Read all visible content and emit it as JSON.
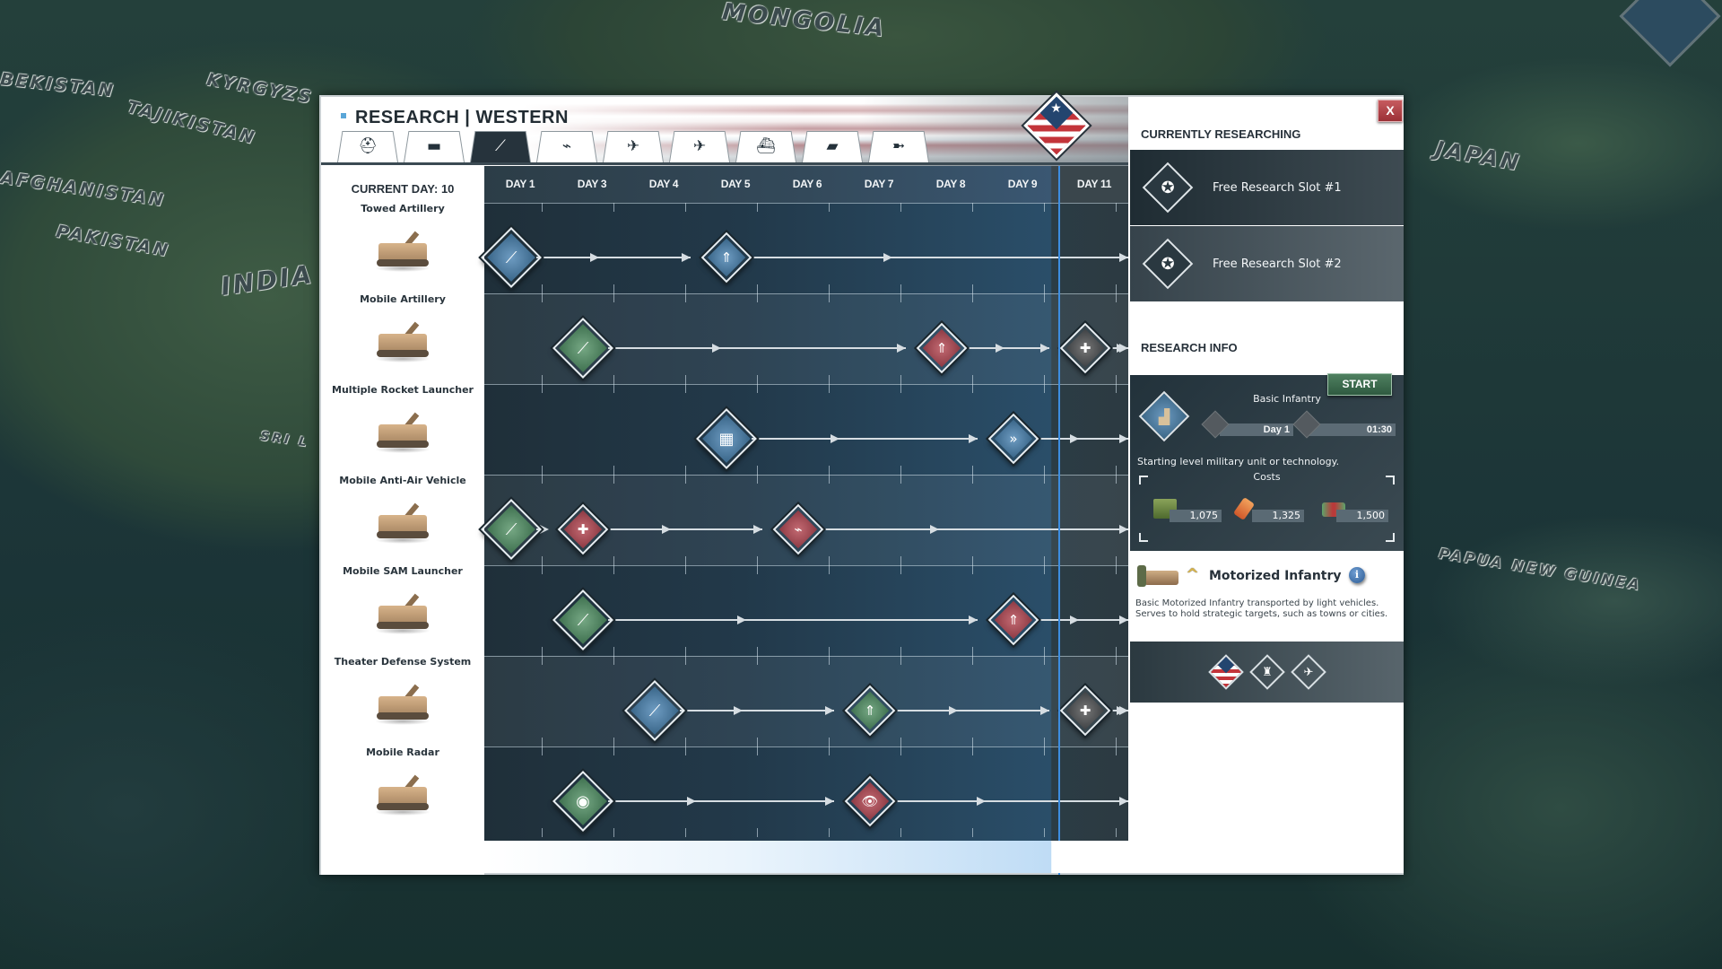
{
  "map": {
    "labels": [
      "MONGOLIA",
      "BEKISTAN",
      "KYRGYZS",
      "TAJIKISTAN",
      "AFGHANISTAN",
      "PAKISTAN",
      "INDIA",
      "SRI L",
      "JAPAN",
      "PAPUA NEW GUINEA"
    ]
  },
  "window": {
    "title": "RESEARCH | WESTERN",
    "close_label": "X",
    "tabs": [
      {
        "name": "infantry",
        "icon": "helmet-icon",
        "glyph": "⛑",
        "active": false
      },
      {
        "name": "tanks",
        "icon": "tank-icon",
        "glyph": "▬",
        "active": false
      },
      {
        "name": "artillery",
        "icon": "artillery-icon",
        "glyph": "⟋",
        "active": true
      },
      {
        "name": "helicopters",
        "icon": "helicopter-icon",
        "glyph": "⌁",
        "active": false
      },
      {
        "name": "fighters",
        "icon": "fighter-jet-icon",
        "glyph": "✈",
        "active": false
      },
      {
        "name": "aircraft",
        "icon": "aircraft-icon",
        "glyph": "✈",
        "active": false
      },
      {
        "name": "ships",
        "icon": "ship-icon",
        "glyph": "⛴",
        "active": false
      },
      {
        "name": "submarines",
        "icon": "submarine-icon",
        "glyph": "▰",
        "active": false
      },
      {
        "name": "missiles",
        "icon": "missile-icon",
        "glyph": "➼",
        "active": false
      }
    ]
  },
  "timeline": {
    "current_day_label": "CURRENT DAY: 10",
    "days": [
      "DAY 1",
      "DAY 3",
      "DAY 4",
      "DAY 5",
      "DAY 6",
      "DAY 7",
      "DAY 8",
      "DAY 9",
      "DAY 11"
    ],
    "current_day_after_column": 7,
    "units": [
      {
        "name": "Towed Artillery",
        "nodes": [
          {
            "col": 0,
            "color": "blue",
            "kind": "unit",
            "glyph": "⟋"
          },
          {
            "col": 3,
            "color": "blue",
            "kind": "upgrade",
            "glyph": "⇑"
          }
        ]
      },
      {
        "name": "Mobile Artillery",
        "nodes": [
          {
            "col": 1,
            "color": "green",
            "kind": "unit",
            "glyph": "⟋"
          },
          {
            "col": 6,
            "color": "red",
            "kind": "upgrade",
            "glyph": "⇑"
          },
          {
            "col": 8,
            "color": "grey",
            "kind": "upgrade",
            "glyph": "✚"
          }
        ]
      },
      {
        "name": "Multiple Rocket Launcher",
        "nodes": [
          {
            "col": 3,
            "color": "blue",
            "kind": "unit",
            "glyph": "▦"
          },
          {
            "col": 7,
            "color": "blue",
            "kind": "upgrade",
            "glyph": "»"
          }
        ]
      },
      {
        "name": "Mobile Anti-Air Vehicle",
        "nodes": [
          {
            "col": 0,
            "color": "green",
            "kind": "unit",
            "glyph": "⟋"
          },
          {
            "col": 1,
            "color": "red",
            "kind": "upgrade",
            "glyph": "✚"
          },
          {
            "col": 4,
            "color": "red",
            "kind": "upgrade",
            "glyph": "⌁"
          }
        ]
      },
      {
        "name": "Mobile SAM Launcher",
        "nodes": [
          {
            "col": 1,
            "color": "green",
            "kind": "unit",
            "glyph": "⟋"
          },
          {
            "col": 7,
            "color": "red",
            "kind": "upgrade",
            "glyph": "⇑"
          }
        ]
      },
      {
        "name": "Theater Defense System",
        "nodes": [
          {
            "col": 2,
            "color": "blue",
            "kind": "unit",
            "glyph": "⟋"
          },
          {
            "col": 5,
            "color": "green",
            "kind": "upgrade",
            "glyph": "⇑"
          },
          {
            "col": 8,
            "color": "grey",
            "kind": "upgrade",
            "glyph": "✚"
          }
        ]
      },
      {
        "name": "Mobile Radar",
        "nodes": [
          {
            "col": 1,
            "color": "green",
            "kind": "unit",
            "glyph": "◉"
          },
          {
            "col": 5,
            "color": "red",
            "kind": "upgrade",
            "glyph": "👁"
          }
        ]
      }
    ]
  },
  "currently_researching": {
    "title": "CURRENTLY RESEARCHING",
    "slots": [
      "Free Research Slot #1",
      "Free Research Slot #2"
    ]
  },
  "research_info": {
    "title": "RESEARCH INFO",
    "start_label": "START",
    "unit_name": "Basic Infantry",
    "day": "Day 1",
    "time": "01:30",
    "description": "Starting level military unit or technology.",
    "costs_label": "Costs",
    "costs": [
      {
        "resource": "supplies",
        "icon": "ammo-crate-icon",
        "value": "1,075"
      },
      {
        "resource": "components",
        "icon": "components-icon",
        "value": "1,325"
      },
      {
        "resource": "money",
        "icon": "cash-icon",
        "value": "1,500"
      }
    ]
  },
  "unit_card": {
    "name": "Motorized Infantry",
    "info_label": "i",
    "description": "Basic Motorized Infantry transported by light vehicles. Serves to hold strategic targets, such as towns or cities.",
    "traits": [
      {
        "icon": "faction-flag-icon",
        "glyph": "★"
      },
      {
        "icon": "fortification-icon",
        "glyph": "♜"
      },
      {
        "icon": "airplane-icon",
        "glyph": "✈"
      }
    ]
  },
  "colors": {
    "accent_blue": "#3d8de0",
    "start_green": "#3f6d50",
    "close_red": "#b0444a",
    "node_blue": "#4f7fa6",
    "node_green": "#5a8a68",
    "node_red": "#a8505a",
    "node_grey": "#5a5d60"
  }
}
